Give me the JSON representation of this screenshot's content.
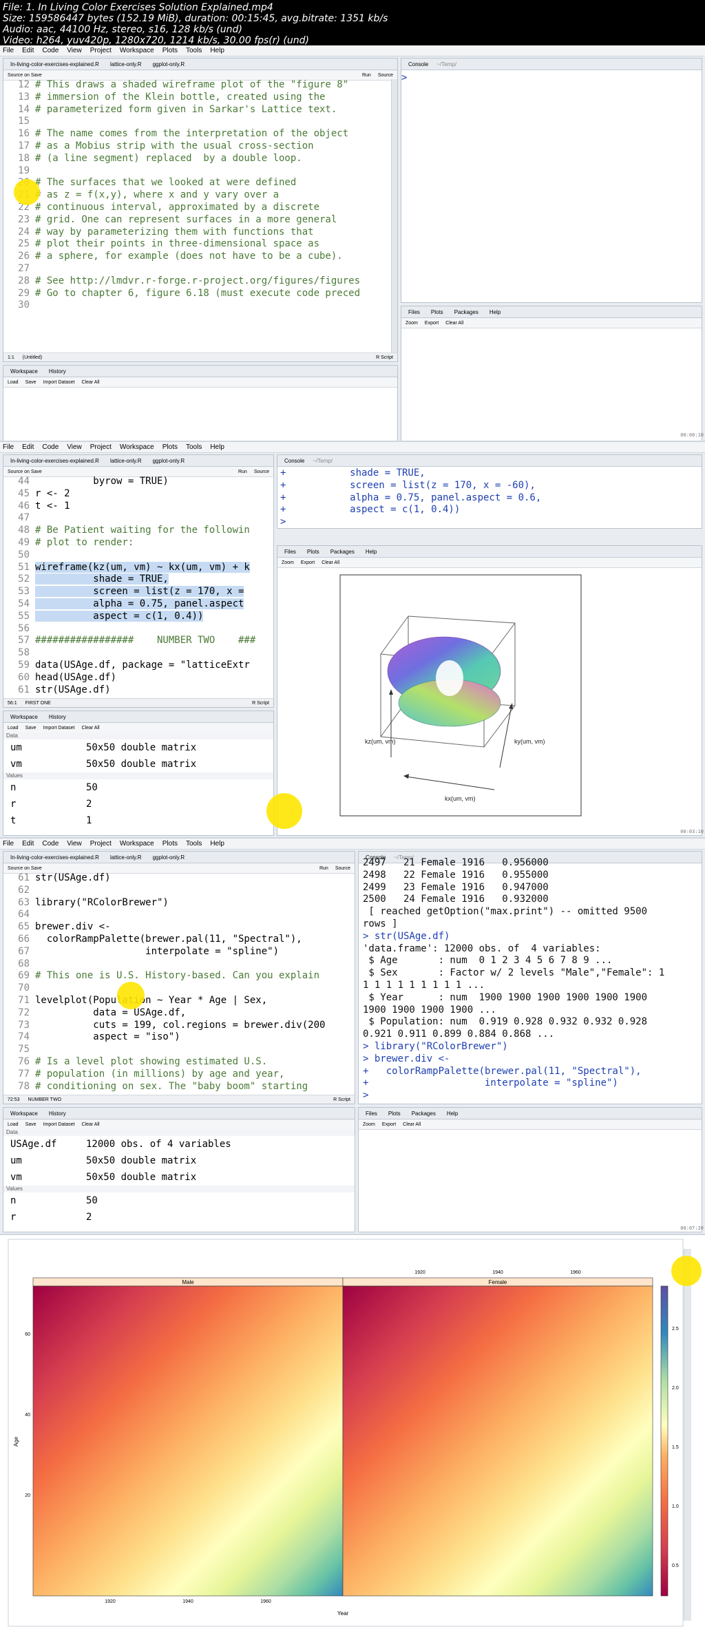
{
  "header": {
    "line1": "File: 1. In Living Color Exercises Solution Explained.mp4",
    "line2": "Size: 159586447 bytes (152.19 MiB), duration: 00:15:45, avg.bitrate: 1351 kb/s",
    "line3": "Audio: aac, 44100 Hz, stereo, s16, 128 kb/s (und)",
    "line4": "Video: h264, yuv420p, 1280x720, 1214 kb/s, 30.00 fps(r) (und)"
  },
  "menu": [
    "File",
    "Edit",
    "Code",
    "View",
    "Project",
    "Workspace",
    "Plots",
    "Tools",
    "Help"
  ],
  "frame1": {
    "editor_tabs": [
      "In-living-color-exercises-explained.R",
      "lattice-only.R",
      "ggplot-only.R"
    ],
    "editor_toolbar": {
      "source_on_save": "Source on Save",
      "run": "Run",
      "source": "Source"
    },
    "code": [
      {
        "n": "12",
        "t": "# This draws a shaded wireframe plot of the \"figure 8\""
      },
      {
        "n": "13",
        "t": "# immersion of the Klein bottle, created using the"
      },
      {
        "n": "14",
        "t": "# parameterized form given in Sarkar's Lattice text."
      },
      {
        "n": "15",
        "t": ""
      },
      {
        "n": "16",
        "t": "# The name comes from the interpretation of the object"
      },
      {
        "n": "17",
        "t": "# as a Mobius strip with the usual cross-section"
      },
      {
        "n": "18",
        "t": "# (a line segment) replaced  by a double loop."
      },
      {
        "n": "19",
        "t": ""
      },
      {
        "n": "20",
        "t": "# The surfaces that we looked at were defined"
      },
      {
        "n": "21",
        "t": "# as z = f(x,y), where x and y vary over a"
      },
      {
        "n": "22",
        "t": "# continuous interval, approximated by a discrete"
      },
      {
        "n": "23",
        "t": "# grid. One can represent surfaces in a more general"
      },
      {
        "n": "24",
        "t": "# way by parameterizing them with functions that"
      },
      {
        "n": "25",
        "t": "# plot their points in three-dimensional space as"
      },
      {
        "n": "26",
        "t": "# a sphere, for example (does not have to be a cube)."
      },
      {
        "n": "27",
        "t": ""
      },
      {
        "n": "28",
        "t": "# See http://lmdvr.r-forge.r-project.org/figures/figures"
      },
      {
        "n": "29",
        "t": "# Go to chapter 6, figure 6.18 (must execute code preced"
      },
      {
        "n": "30",
        "t": ""
      }
    ],
    "status_left": "1:1",
    "status_mid": "(Untitled)",
    "status_right": "R Script",
    "console_title": "Console",
    "console_path": "~/Temp/",
    "console_prompt": ">",
    "env_tabs": [
      "Workspace",
      "History"
    ],
    "env_toolbar": [
      "Load",
      "Save",
      "Import Dataset",
      "Clear All"
    ],
    "files_tabs": [
      "Files",
      "Plots",
      "Packages",
      "Help"
    ],
    "files_toolbar": [
      "Zoom",
      "Export",
      "Clear All"
    ],
    "timestamp": "00:00:10"
  },
  "frame2": {
    "code": [
      {
        "n": "44",
        "t": "          byrow = TRUE)"
      },
      {
        "n": "45",
        "t": "r <- 2"
      },
      {
        "n": "46",
        "t": "t <- 1"
      },
      {
        "n": "47",
        "t": ""
      },
      {
        "n": "48",
        "t": "# Be Patient waiting for the followin"
      },
      {
        "n": "49",
        "t": "# plot to render:"
      },
      {
        "n": "50",
        "t": ""
      },
      {
        "n": "51",
        "t": "wireframe(kz(um, vm) ~ kx(um, vm) + k"
      },
      {
        "n": "52",
        "t": "          shade = TRUE,"
      },
      {
        "n": "53",
        "t": "          screen = list(z = 170, x ="
      },
      {
        "n": "54",
        "t": "          alpha = 0.75, panel.aspect"
      },
      {
        "n": "55",
        "t": "          aspect = c(1, 0.4))"
      },
      {
        "n": "56",
        "t": ""
      },
      {
        "n": "57",
        "t": "#################    NUMBER TWO    ###"
      },
      {
        "n": "58",
        "t": ""
      },
      {
        "n": "59",
        "t": "data(USAge.df, package = \"latticeExtr"
      },
      {
        "n": "60",
        "t": "head(USAge.df)"
      },
      {
        "n": "61",
        "t": "str(USAge.df)"
      }
    ],
    "status_left": "56:1",
    "status_mid": "FIRST ONE",
    "status_right": "R Script",
    "console": [
      {
        "t": "+           shade = TRUE,",
        "c": "in"
      },
      {
        "t": "+           screen = list(z = 170, x = -60),",
        "c": "in"
      },
      {
        "t": "+           alpha = 0.75, panel.aspect = 0.6,",
        "c": "in"
      },
      {
        "t": "+           aspect = c(1, 0.4))",
        "c": "in"
      },
      {
        "t": ">",
        "c": "in"
      },
      {
        "t": "> |",
        "c": "in"
      }
    ],
    "env": [
      {
        "section": "Data"
      },
      {
        "k": "um",
        "v": "50x50 double matrix"
      },
      {
        "k": "vm",
        "v": "50x50 double matrix"
      },
      {
        "section": "Values"
      },
      {
        "k": "n",
        "v": "50"
      },
      {
        "k": "r",
        "v": "2"
      },
      {
        "k": "t",
        "v": "1"
      }
    ],
    "plot_labels": {
      "z": "kz(um, vm)",
      "y": "ky(um, vm)",
      "x": "kx(um, vm)"
    },
    "timestamp": "00:03:10"
  },
  "frame3": {
    "code": [
      {
        "n": "61",
        "t": "str(USAge.df)"
      },
      {
        "n": "62",
        "t": ""
      },
      {
        "n": "63",
        "t": "library(\"RColorBrewer\")"
      },
      {
        "n": "64",
        "t": ""
      },
      {
        "n": "65",
        "t": "brewer.div <-"
      },
      {
        "n": "66",
        "t": "  colorRampPalette(brewer.pal(11, \"Spectral\"),"
      },
      {
        "n": "67",
        "t": "                   interpolate = \"spline\")"
      },
      {
        "n": "68",
        "t": ""
      },
      {
        "n": "69",
        "t": "# This one is U.S. History-based. Can you explain"
      },
      {
        "n": "70",
        "t": ""
      },
      {
        "n": "71",
        "t": "levelplot(Population ~ Year * Age | Sex,"
      },
      {
        "n": "72",
        "t": "          data = USAge.df,"
      },
      {
        "n": "73",
        "t": "          cuts = 199, col.regions = brewer.div(200"
      },
      {
        "n": "74",
        "t": "          aspect = \"iso\")"
      },
      {
        "n": "75",
        "t": ""
      },
      {
        "n": "76",
        "t": "# Is a level plot showing estimated U.S."
      },
      {
        "n": "77",
        "t": "# population (in millions) by age and year,"
      },
      {
        "n": "78",
        "t": "# conditioning on sex. The \"baby boom\" starting"
      }
    ],
    "status_left": "72:53",
    "status_mid": "NUMBER TWO",
    "status_right": "R Script",
    "console": [
      {
        "t": "2497   21 Female 1916   0.956000",
        "c": ""
      },
      {
        "t": "2498   22 Female 1916   0.955000",
        "c": ""
      },
      {
        "t": "2499   23 Female 1916   0.947000",
        "c": ""
      },
      {
        "t": "2500   24 Female 1916   0.932000",
        "c": ""
      },
      {
        "t": " [ reached getOption(\"max.print\") -- omitted 9500",
        "c": ""
      },
      {
        "t": "rows ]",
        "c": ""
      },
      {
        "t": "> str(USAge.df)",
        "c": "in"
      },
      {
        "t": "'data.frame': 12000 obs. of  4 variables:",
        "c": ""
      },
      {
        "t": " $ Age       : num  0 1 2 3 4 5 6 7 8 9 ...",
        "c": ""
      },
      {
        "t": " $ Sex       : Factor w/ 2 levels \"Male\",\"Female\": 1",
        "c": ""
      },
      {
        "t": "1 1 1 1 1 1 1 1 1 ...",
        "c": ""
      },
      {
        "t": " $ Year      : num  1900 1900 1900 1900 1900 1900",
        "c": ""
      },
      {
        "t": "1900 1900 1900 1900 ...",
        "c": ""
      },
      {
        "t": " $ Population: num  0.919 0.928 0.932 0.932 0.928",
        "c": ""
      },
      {
        "t": "0.921 0.911 0.899 0.884 0.868 ...",
        "c": ""
      },
      {
        "t": "> library(\"RColorBrewer\")",
        "c": "in"
      },
      {
        "t": "> brewer.div <-",
        "c": "in"
      },
      {
        "t": "+   colorRampPalette(brewer.pal(11, \"Spectral\"),",
        "c": "in"
      },
      {
        "t": "+                    interpolate = \"spline\")",
        "c": "in"
      },
      {
        "t": ">",
        "c": "in"
      }
    ],
    "env": [
      {
        "section": "Data"
      },
      {
        "k": "USAge.df",
        "v": "12000 obs. of 4 variables"
      },
      {
        "k": "um",
        "v": "50x50 double matrix"
      },
      {
        "k": "vm",
        "v": "50x50 double matrix"
      },
      {
        "section": "Values"
      },
      {
        "k": "n",
        "v": "50"
      },
      {
        "k": "r",
        "v": "2"
      }
    ],
    "timestamp": "00:07:20"
  },
  "frame4": {
    "panels": [
      "Male",
      "Female"
    ],
    "xlabel": "Year",
    "ylabel": "Age",
    "x_ticks": [
      "1920",
      "1940",
      "1960"
    ],
    "y_ticks": [
      "20",
      "40",
      "60"
    ],
    "colorkey_ticks": [
      "0.5",
      "1.0",
      "1.5",
      "2.0",
      "2.5"
    ],
    "timestamp": "00:11:30"
  }
}
